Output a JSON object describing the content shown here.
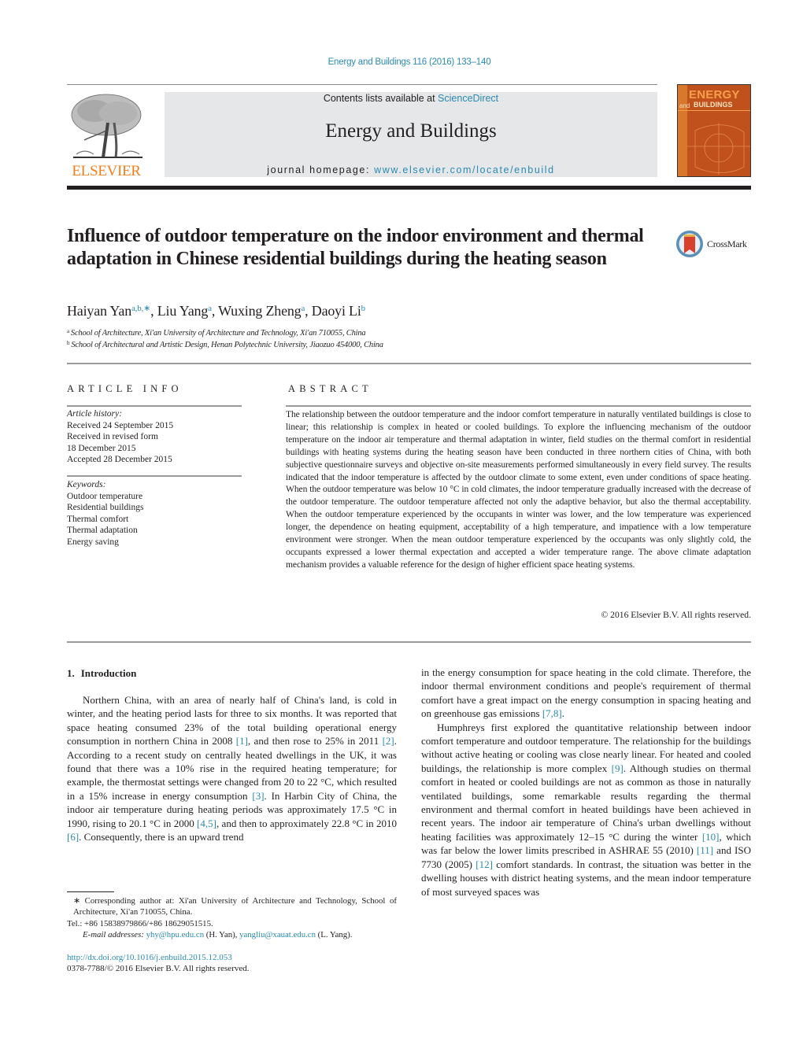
{
  "header": {
    "citation": "Energy and Buildings 116 (2016) 133–140",
    "contents_prefix": "Contents lists available at ",
    "contents_link": "ScienceDirect",
    "journal_title": "Energy and Buildings",
    "homepage_prefix": "journal homepage: ",
    "homepage_link": "www.elsevier.com/locate/enbuild",
    "publisher_logo_text": "ELSEVIER",
    "cover": {
      "title_line1": "ENERGY",
      "title_and": "and",
      "title_line2": "BUILDINGS"
    },
    "colors": {
      "link": "#2a8ab3",
      "elsevier_orange": "#f07f1c",
      "banner_bg": "#e6e7e8",
      "cover_bg": "#c1511c"
    }
  },
  "article": {
    "title": "Influence of outdoor temperature on the indoor environment and thermal adaptation in Chinese residential buildings during the heating season",
    "crossmark_label": "CrossMark",
    "authors": [
      {
        "name": "Haiyan Yan",
        "affil": "a,b,∗"
      },
      {
        "name": "Liu Yang",
        "affil": "a"
      },
      {
        "name": "Wuxing Zheng",
        "affil": "a"
      },
      {
        "name": "Daoyi Li",
        "affil": "b"
      }
    ],
    "author_separator": ", ",
    "affiliations": [
      {
        "mark": "a",
        "text": "School of Architecture, Xi'an University of Architecture and Technology, Xi'an 710055, China"
      },
      {
        "mark": "b",
        "text": "School of Architectural and Artistic Design, Henan Polytechnic University, Jiaozuo 454000, China"
      }
    ]
  },
  "article_info": {
    "heading": "ARTICLE INFO",
    "history_label": "Article history:",
    "history": [
      "Received 24 September 2015",
      "Received in revised form",
      "18 December 2015",
      "Accepted 28 December 2015"
    ],
    "keywords_label": "Keywords:",
    "keywords": [
      "Outdoor temperature",
      "Residential buildings",
      "Thermal comfort",
      "Thermal adaptation",
      "Energy saving"
    ]
  },
  "abstract": {
    "heading": "ABSTRACT",
    "text": "The relationship between the outdoor temperature and the indoor comfort temperature in naturally ventilated buildings is close to linear; this relationship is complex in heated or cooled buildings. To explore the influencing mechanism of the outdoor temperature on the indoor air temperature and thermal adaptation in winter, field studies on the thermal comfort in residential buildings with heating systems during the heating season have been conducted in three northern cities of China, with both subjective questionnaire surveys and objective on-site measurements performed simultaneously in every field survey. The results indicated that the indoor temperature is affected by the outdoor climate to some extent, even under conditions of space heating. When the outdoor temperature was below 10 °C in cold climates, the indoor temperature gradually increased with the decrease of the outdoor temperature. The outdoor temperature affected not only the adaptive behavior, but also the thermal acceptability. When the outdoor temperature experienced by the occupants in winter was lower, and the low temperature was experienced longer, the dependence on heating equipment, acceptability of a high temperature, and impatience with a low temperature environment were stronger. When the mean outdoor temperature experienced by the occupants was only slightly cold, the occupants expressed a lower thermal expectation and accepted a wider temperature range. The above climate adaptation mechanism provides a valuable reference for the design of higher efficient space heating systems.",
    "copyright": "© 2016 Elsevier B.V. All rights reserved."
  },
  "introduction": {
    "number": "1.",
    "heading": "Introduction",
    "left_column": [
      {
        "t": "Northern China, with an area of nearly half of China's land, is cold in winter, and the heating period lasts for three to six months. It was reported that space heating consumed 23% of the total building operational energy consumption in northern China in 2008 "
      },
      {
        "ref": "[1]"
      },
      {
        "t": ", and then rose to 25% in 2011 "
      },
      {
        "ref": "[2]"
      },
      {
        "t": ". According to a recent study on centrally heated dwellings in the UK, it was found that there was a 10% rise in the required heating temperature; for example, the thermostat settings were changed from 20 to 22 °C, which resulted in a 15% increase in energy consumption "
      },
      {
        "ref": "[3]"
      },
      {
        "t": ". In Harbin City of China, the indoor air temperature during heating periods was approximately 17.5 °C in 1990, rising to 20.1 °C in 2000 "
      },
      {
        "ref": "[4,5]"
      },
      {
        "t": ", and then to approximately 22.8 °C in 2010 "
      },
      {
        "ref": "[6]"
      },
      {
        "t": ". Consequently, there is an upward trend"
      }
    ],
    "right_column_p1": [
      {
        "t": "in the energy consumption for space heating in the cold climate. Therefore, the indoor thermal environment conditions and people's requirement of thermal comfort have a great impact on the energy consumption in spacing heating and on greenhouse gas emissions "
      },
      {
        "ref": "[7,8]"
      },
      {
        "t": "."
      }
    ],
    "right_column_p2": [
      {
        "t": "Humphreys first explored the quantitative relationship between indoor comfort temperature and outdoor temperature. The relationship for the buildings without active heating or cooling was close nearly linear. For heated and cooled buildings, the relationship is more complex "
      },
      {
        "ref": "[9]"
      },
      {
        "t": ". Although studies on thermal comfort in heated or cooled buildings are not as common as those in naturally ventilated buildings, some remarkable results regarding the thermal environment and thermal comfort in heated buildings have been achieved in recent years. The indoor air temperature of China's urban dwellings without heating facilities was approximately 12–15 °C during the winter "
      },
      {
        "ref": "[10]"
      },
      {
        "t": ", which was far below the lower limits prescribed in ASHRAE 55 (2010) "
      },
      {
        "ref": "[11]"
      },
      {
        "t": " and ISO 7730 (2005) "
      },
      {
        "ref": "[12]"
      },
      {
        "t": " comfort standards. In contrast, the situation was better in the dwelling houses with district heating systems, and the mean indoor temperature of most surveyed spaces was"
      }
    ]
  },
  "footnote": {
    "corresponding": "∗ Corresponding author at: Xi'an University of Architecture and Technology, School of Architecture, Xi'an 710055, China.",
    "tel": "Tel.: +86 15838979866/+86 18629051515.",
    "email_label": "E-mail addresses: ",
    "email1": "yhy@hpu.edu.cn",
    "email1_owner": " (H. Yan), ",
    "email2": "yangliu@xauat.edu.cn",
    "email2_owner": " (L. Yang)."
  },
  "footer": {
    "doi": "http://dx.doi.org/10.1016/j.enbuild.2015.12.053",
    "issn": "0378-7788/© 2016 Elsevier B.V. All rights reserved."
  }
}
